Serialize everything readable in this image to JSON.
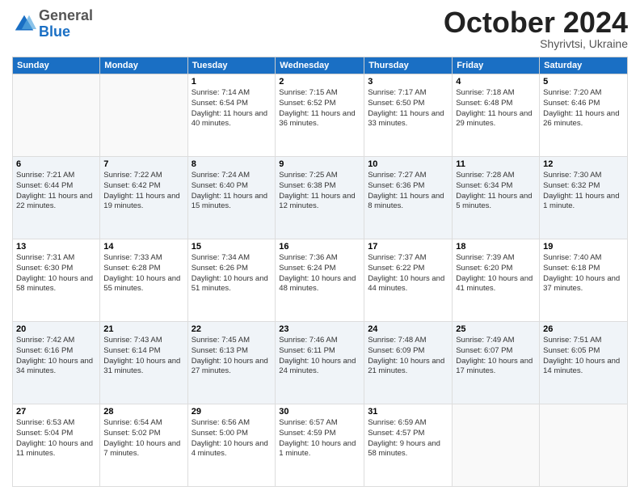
{
  "header": {
    "logo_line1": "General",
    "logo_line2": "Blue",
    "month": "October 2024",
    "location": "Shyrivtsi, Ukraine"
  },
  "days_of_week": [
    "Sunday",
    "Monday",
    "Tuesday",
    "Wednesday",
    "Thursday",
    "Friday",
    "Saturday"
  ],
  "weeks": [
    [
      {
        "day": "",
        "content": ""
      },
      {
        "day": "",
        "content": ""
      },
      {
        "day": "1",
        "content": "Sunrise: 7:14 AM\nSunset: 6:54 PM\nDaylight: 11 hours and 40 minutes."
      },
      {
        "day": "2",
        "content": "Sunrise: 7:15 AM\nSunset: 6:52 PM\nDaylight: 11 hours and 36 minutes."
      },
      {
        "day": "3",
        "content": "Sunrise: 7:17 AM\nSunset: 6:50 PM\nDaylight: 11 hours and 33 minutes."
      },
      {
        "day": "4",
        "content": "Sunrise: 7:18 AM\nSunset: 6:48 PM\nDaylight: 11 hours and 29 minutes."
      },
      {
        "day": "5",
        "content": "Sunrise: 7:20 AM\nSunset: 6:46 PM\nDaylight: 11 hours and 26 minutes."
      }
    ],
    [
      {
        "day": "6",
        "content": "Sunrise: 7:21 AM\nSunset: 6:44 PM\nDaylight: 11 hours and 22 minutes."
      },
      {
        "day": "7",
        "content": "Sunrise: 7:22 AM\nSunset: 6:42 PM\nDaylight: 11 hours and 19 minutes."
      },
      {
        "day": "8",
        "content": "Sunrise: 7:24 AM\nSunset: 6:40 PM\nDaylight: 11 hours and 15 minutes."
      },
      {
        "day": "9",
        "content": "Sunrise: 7:25 AM\nSunset: 6:38 PM\nDaylight: 11 hours and 12 minutes."
      },
      {
        "day": "10",
        "content": "Sunrise: 7:27 AM\nSunset: 6:36 PM\nDaylight: 11 hours and 8 minutes."
      },
      {
        "day": "11",
        "content": "Sunrise: 7:28 AM\nSunset: 6:34 PM\nDaylight: 11 hours and 5 minutes."
      },
      {
        "day": "12",
        "content": "Sunrise: 7:30 AM\nSunset: 6:32 PM\nDaylight: 11 hours and 1 minute."
      }
    ],
    [
      {
        "day": "13",
        "content": "Sunrise: 7:31 AM\nSunset: 6:30 PM\nDaylight: 10 hours and 58 minutes."
      },
      {
        "day": "14",
        "content": "Sunrise: 7:33 AM\nSunset: 6:28 PM\nDaylight: 10 hours and 55 minutes."
      },
      {
        "day": "15",
        "content": "Sunrise: 7:34 AM\nSunset: 6:26 PM\nDaylight: 10 hours and 51 minutes."
      },
      {
        "day": "16",
        "content": "Sunrise: 7:36 AM\nSunset: 6:24 PM\nDaylight: 10 hours and 48 minutes."
      },
      {
        "day": "17",
        "content": "Sunrise: 7:37 AM\nSunset: 6:22 PM\nDaylight: 10 hours and 44 minutes."
      },
      {
        "day": "18",
        "content": "Sunrise: 7:39 AM\nSunset: 6:20 PM\nDaylight: 10 hours and 41 minutes."
      },
      {
        "day": "19",
        "content": "Sunrise: 7:40 AM\nSunset: 6:18 PM\nDaylight: 10 hours and 37 minutes."
      }
    ],
    [
      {
        "day": "20",
        "content": "Sunrise: 7:42 AM\nSunset: 6:16 PM\nDaylight: 10 hours and 34 minutes."
      },
      {
        "day": "21",
        "content": "Sunrise: 7:43 AM\nSunset: 6:14 PM\nDaylight: 10 hours and 31 minutes."
      },
      {
        "day": "22",
        "content": "Sunrise: 7:45 AM\nSunset: 6:13 PM\nDaylight: 10 hours and 27 minutes."
      },
      {
        "day": "23",
        "content": "Sunrise: 7:46 AM\nSunset: 6:11 PM\nDaylight: 10 hours and 24 minutes."
      },
      {
        "day": "24",
        "content": "Sunrise: 7:48 AM\nSunset: 6:09 PM\nDaylight: 10 hours and 21 minutes."
      },
      {
        "day": "25",
        "content": "Sunrise: 7:49 AM\nSunset: 6:07 PM\nDaylight: 10 hours and 17 minutes."
      },
      {
        "day": "26",
        "content": "Sunrise: 7:51 AM\nSunset: 6:05 PM\nDaylight: 10 hours and 14 minutes."
      }
    ],
    [
      {
        "day": "27",
        "content": "Sunrise: 6:53 AM\nSunset: 5:04 PM\nDaylight: 10 hours and 11 minutes."
      },
      {
        "day": "28",
        "content": "Sunrise: 6:54 AM\nSunset: 5:02 PM\nDaylight: 10 hours and 7 minutes."
      },
      {
        "day": "29",
        "content": "Sunrise: 6:56 AM\nSunset: 5:00 PM\nDaylight: 10 hours and 4 minutes."
      },
      {
        "day": "30",
        "content": "Sunrise: 6:57 AM\nSunset: 4:59 PM\nDaylight: 10 hours and 1 minute."
      },
      {
        "day": "31",
        "content": "Sunrise: 6:59 AM\nSunset: 4:57 PM\nDaylight: 9 hours and 58 minutes."
      },
      {
        "day": "",
        "content": ""
      },
      {
        "day": "",
        "content": ""
      }
    ]
  ]
}
